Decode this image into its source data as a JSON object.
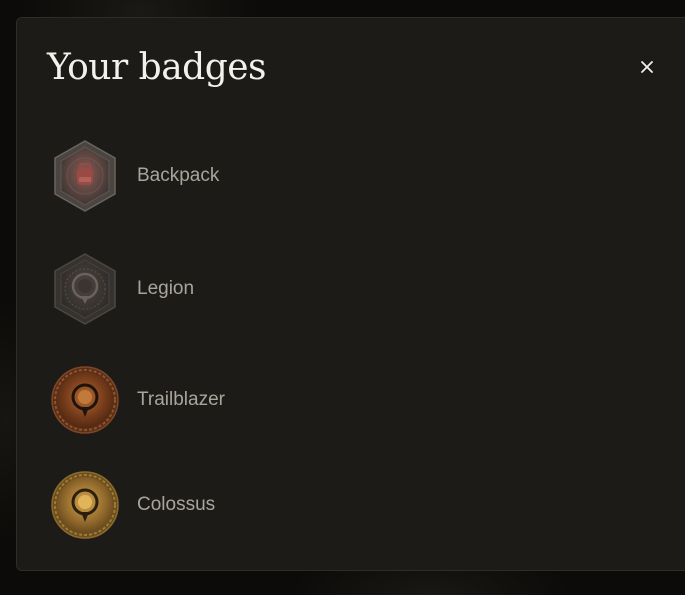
{
  "modal": {
    "title": "Your badges",
    "close_icon": "close-icon"
  },
  "badges": [
    {
      "label": "Backpack",
      "icon": "backpack-badge-icon",
      "shape": "hexagon",
      "color": "#6b4a44"
    },
    {
      "label": "Legion",
      "icon": "legion-badge-icon",
      "shape": "hexagon",
      "color": "#3b3632"
    },
    {
      "label": "Trailblazer",
      "icon": "trailblazer-badge-icon",
      "shape": "circle",
      "color": "#7a3f1c"
    },
    {
      "label": "Colossus",
      "icon": "colossus-badge-icon",
      "shape": "circle",
      "color": "#8a6526"
    }
  ]
}
